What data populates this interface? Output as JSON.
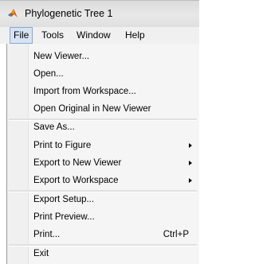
{
  "window": {
    "title": "Phylogenetic Tree 1",
    "app_icon": "matlab-logo-icon"
  },
  "menubar": {
    "items": [
      {
        "label": "File",
        "active": true
      },
      {
        "label": "Tools"
      },
      {
        "label": "Window"
      },
      {
        "label": "Help"
      }
    ]
  },
  "file_menu": {
    "items": [
      {
        "label": "New Viewer..."
      },
      {
        "label": "Open..."
      },
      {
        "label": "Import from Workspace..."
      },
      {
        "label": "Open Original in New Viewer"
      },
      {
        "label": "Save As..."
      },
      {
        "label": "Print to Figure",
        "submenu": true
      },
      {
        "label": "Export to New Viewer",
        "submenu": true
      },
      {
        "label": "Export to Workspace",
        "submenu": true
      },
      {
        "label": "Export Setup..."
      },
      {
        "label": "Print Preview..."
      },
      {
        "label": "Print...",
        "shortcut": "Ctrl+P"
      },
      {
        "label": "Exit"
      }
    ]
  },
  "colors": {
    "active_menu_bg": "#d6e3f3",
    "active_menu_border": "#8aa8d4",
    "menu_bg": "#f5f5f5"
  }
}
